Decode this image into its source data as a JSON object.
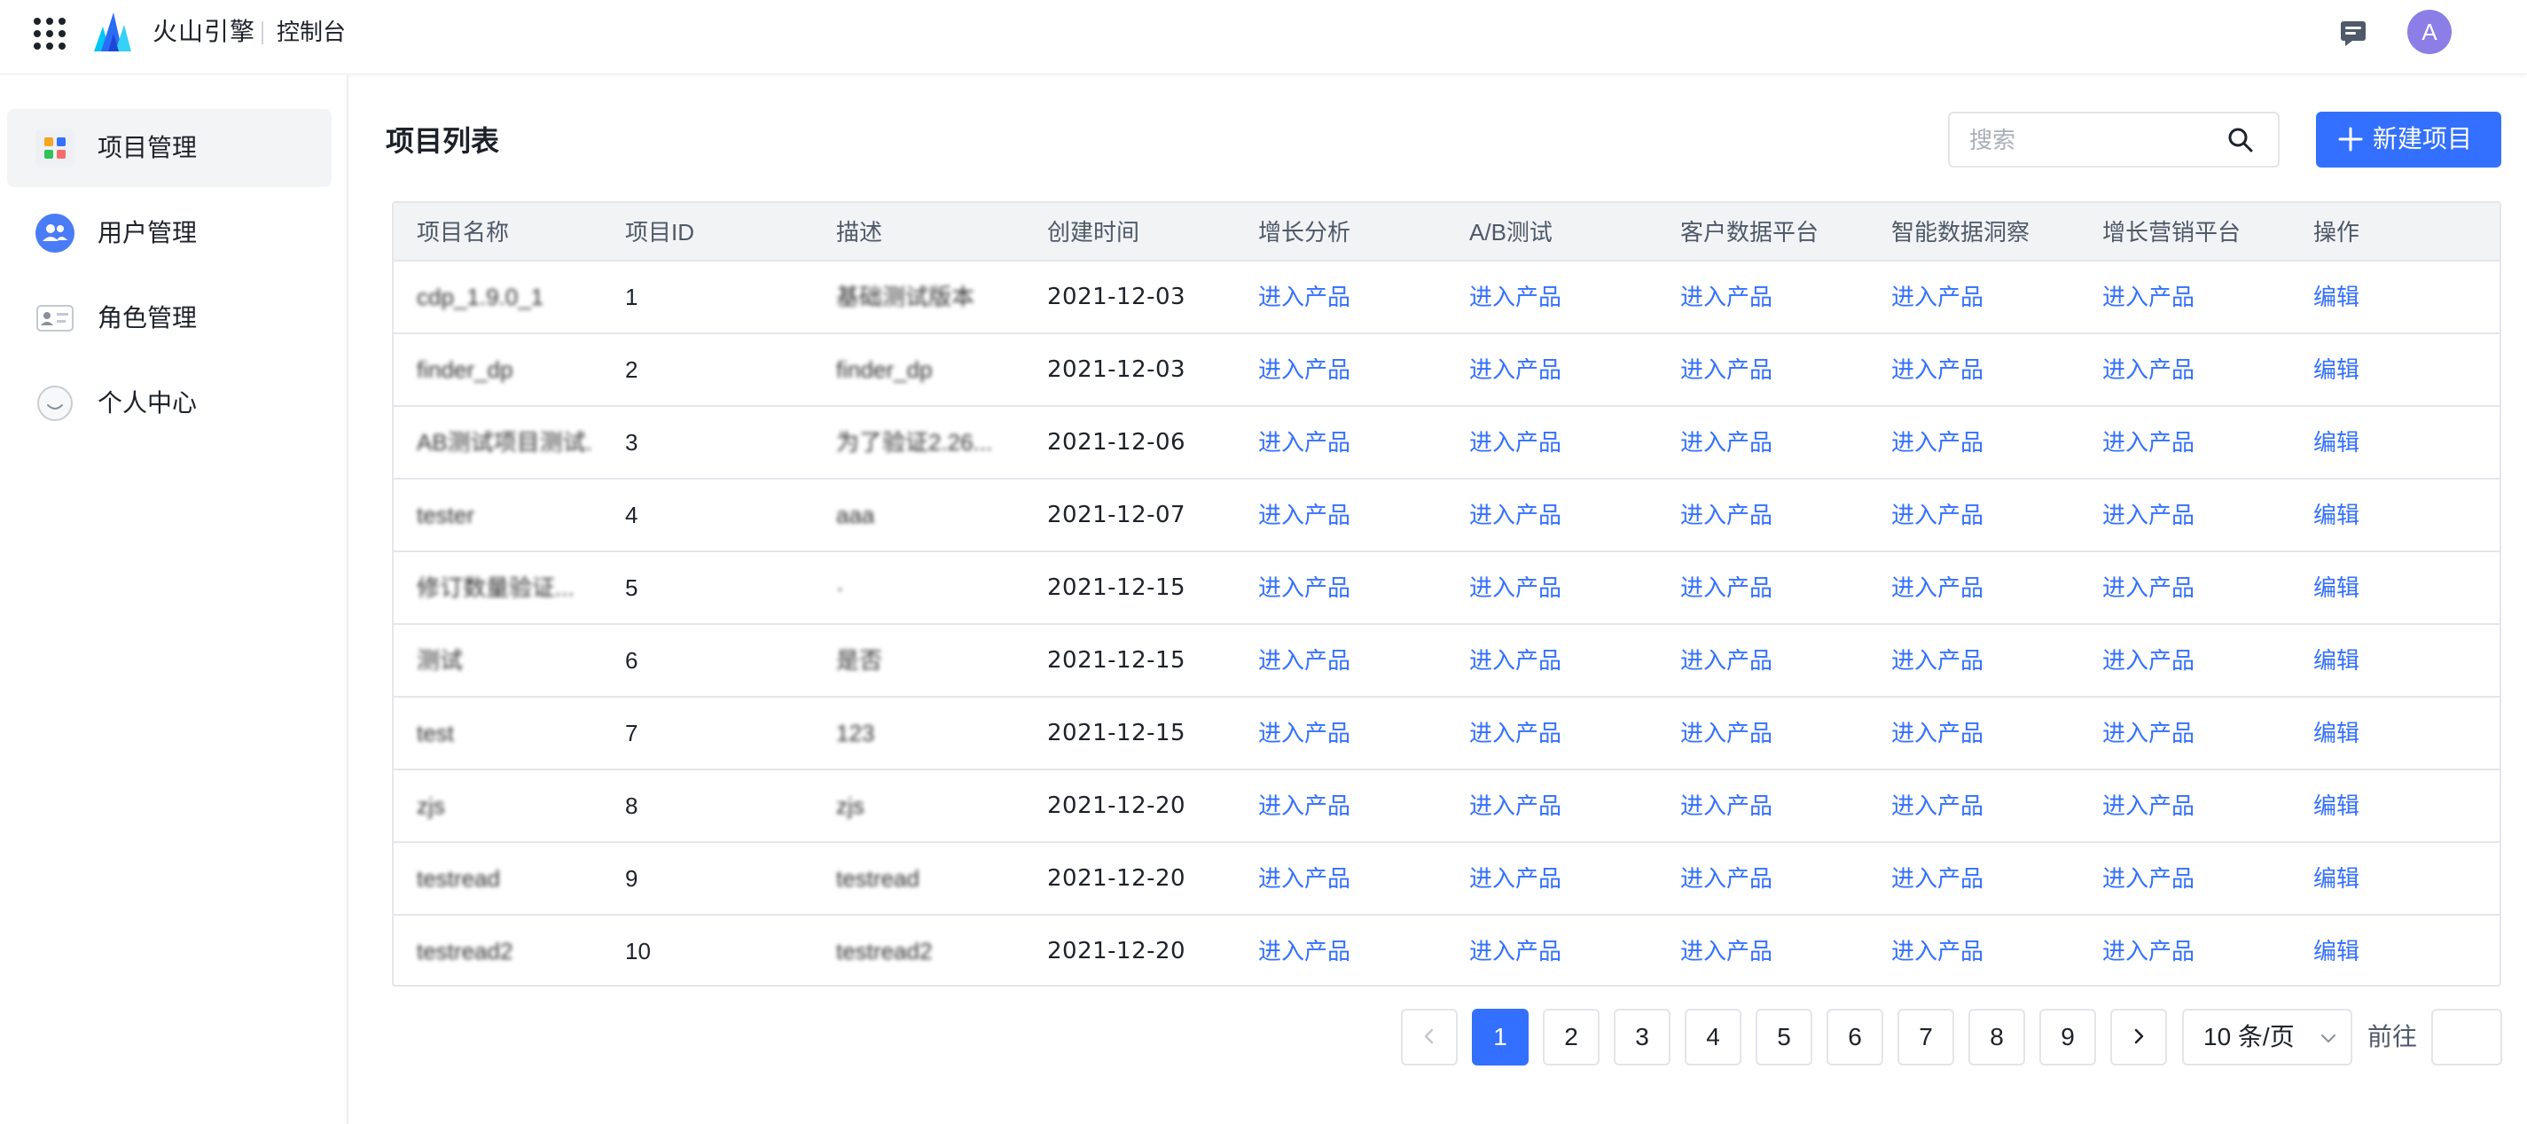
{
  "topbar": {
    "brand": "火山引擎",
    "console": "控制台",
    "avatar_letter": "A"
  },
  "sidebar": {
    "items": [
      {
        "label": "项目管理",
        "icon": "project-grid-icon",
        "active": true
      },
      {
        "label": "用户管理",
        "icon": "users-icon",
        "active": false
      },
      {
        "label": "角色管理",
        "icon": "role-card-icon",
        "active": false
      },
      {
        "label": "个人中心",
        "icon": "personal-face-icon",
        "active": false
      }
    ]
  },
  "main": {
    "title": "项目列表",
    "search_placeholder": "搜索",
    "new_button": "新建项目"
  },
  "table": {
    "columns": [
      "项目名称",
      "项目ID",
      "描述",
      "创建时间",
      "增长分析",
      "A/B测试",
      "客户数据平台",
      "智能数据洞察",
      "增长营销平台",
      "操作"
    ],
    "link_text": "进入产品",
    "action_text": "编辑",
    "rows": [
      {
        "name": "cdp_1.9.0_1",
        "id": "1",
        "desc": "基础测试版本",
        "created": "2021-12-03"
      },
      {
        "name": "finder_dp",
        "id": "2",
        "desc": "finder_dp",
        "created": "2021-12-03"
      },
      {
        "name": "AB测试项目测试...",
        "id": "3",
        "desc": "为了验证2.26...",
        "created": "2021-12-06"
      },
      {
        "name": "tester",
        "id": "4",
        "desc": "aaa",
        "created": "2021-12-07"
      },
      {
        "name": "修订数量验证...",
        "id": "5",
        "desc": "·",
        "created": "2021-12-15"
      },
      {
        "name": "测试",
        "id": "6",
        "desc": "是否",
        "created": "2021-12-15"
      },
      {
        "name": "test",
        "id": "7",
        "desc": "123",
        "created": "2021-12-15"
      },
      {
        "name": "zjs",
        "id": "8",
        "desc": "zjs",
        "created": "2021-12-20"
      },
      {
        "name": "testread",
        "id": "9",
        "desc": "testread",
        "created": "2021-12-20"
      },
      {
        "name": "testread2",
        "id": "10",
        "desc": "testread2",
        "created": "2021-12-20"
      }
    ]
  },
  "pagination": {
    "pages": [
      "1",
      "2",
      "3",
      "4",
      "5",
      "6",
      "7",
      "8",
      "9"
    ],
    "current": "1",
    "page_size": "10 条/页",
    "goto_label": "前往"
  }
}
